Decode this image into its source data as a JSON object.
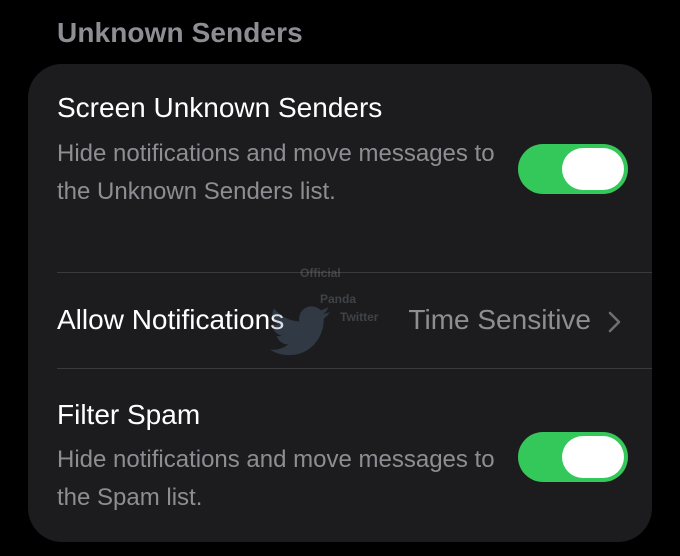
{
  "section": {
    "header": "Unknown Senders"
  },
  "rows": {
    "screen_unknown": {
      "title": "Screen Unknown Senders",
      "subtitle": "Hide notifications and move messages to the Unknown Senders list.",
      "toggle_on": true
    },
    "allow_notifications": {
      "title": "Allow Notifications",
      "value": "Time Sensitive",
      "icon": "chevron-right-icon"
    },
    "filter_spam": {
      "title": "Filter Spam",
      "subtitle": "Hide notifications and move messages to the Spam list.",
      "toggle_on": true
    }
  },
  "watermark": {
    "line1": "Official",
    "line2": "Panda",
    "line3": "Twitter",
    "icon": "bird-logo-icon"
  },
  "colors": {
    "background": "#000000",
    "card": "#1c1c1e",
    "toggle_on": "#34c759",
    "secondary_text": "#8d8d93",
    "divider": "#3a3a3c"
  }
}
